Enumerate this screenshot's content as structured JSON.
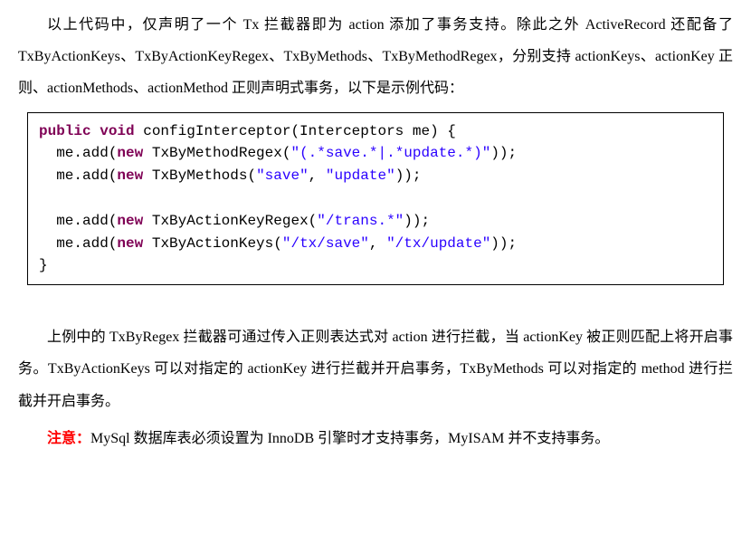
{
  "para1": "以上代码中，仅声明了一个 Tx 拦截器即为 action 添加了事务支持。除此之外 ActiveRecord 还配备了 TxByActionKeys、TxByActionKeyRegex、TxByMethods、TxByMethodRegex，分别支持 actionKeys、actionKey 正则、actionMethods、actionMethod 正则声明式事务，以下是示例代码：",
  "code": {
    "kw_public": "public",
    "kw_void": "void",
    "kw_new": "new",
    "fn_name": " configInterceptor(Interceptors me) {",
    "l1a": "  me.add(",
    "l1b": " TxByMethodRegex(",
    "l1str": "\"(.*save.*|.*update.*)\"",
    "l1c": "));",
    "l2b": " TxByMethods(",
    "l2str1": "\"save\"",
    "l2sep": ", ",
    "l2str2": "\"update\"",
    "l2c": "));",
    "l3b": " TxByActionKeyRegex(",
    "l3str": "\"/trans.*\"",
    "l3c": "));",
    "l4b": " TxByActionKeys(",
    "l4str1": "\"/tx/save\"",
    "l4sep": ", ",
    "l4str2": "\"/tx/update\"",
    "l4c": "));",
    "close": "}"
  },
  "para2": "上例中的 TxByRegex 拦截器可通过传入正则表达式对 action 进行拦截，当 actionKey 被正则匹配上将开启事务。TxByActionKeys 可以对指定的 actionKey 进行拦截并开启事务，TxByMethods 可以对指定的 method 进行拦截并开启事务。",
  "note_label": "注意：",
  "note_text": "MySql 数据库表必须设置为 InnoDB 引擎时才支持事务，MyISAM 并不支持事务。"
}
